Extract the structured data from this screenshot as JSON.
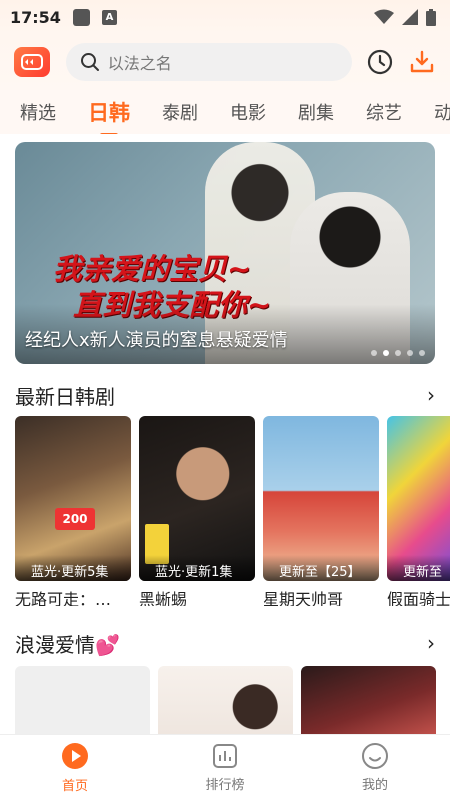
{
  "status_bar": {
    "time": "17:54"
  },
  "header": {
    "search_placeholder": "以法之名"
  },
  "tabs": [
    "精选",
    "日韩",
    "泰剧",
    "电影",
    "剧集",
    "综艺",
    "动"
  ],
  "banner": {
    "title_line1": "我亲爱的宝贝~",
    "title_line2": "直到我支配你~",
    "caption": "经纪人x新人演员的窒息悬疑爱情",
    "dot_count": 5,
    "active_dot": 1
  },
  "section1": {
    "title": "最新日韩剧",
    "items": [
      {
        "badge": "蓝光·更新5集",
        "name": "无路可走：…"
      },
      {
        "badge": "蓝光·更新1集",
        "name": "黑蜥蜴"
      },
      {
        "badge": "更新至【25】",
        "name": "星期天帅哥"
      },
      {
        "badge": "更新至",
        "name": "假面骑士"
      }
    ]
  },
  "section2": {
    "title": "浪漫爱情💕"
  },
  "nav": {
    "home": "首页",
    "rank": "排行榜",
    "mine": "我的"
  },
  "colors": {
    "accent": "#ff6a1f"
  }
}
